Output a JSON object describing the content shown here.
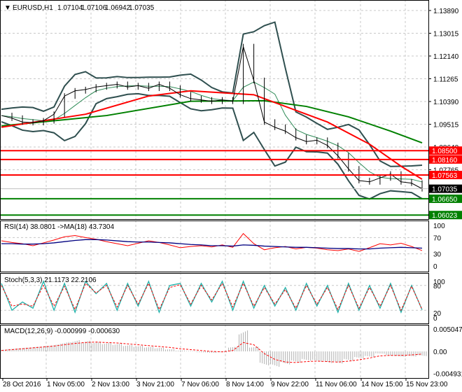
{
  "chart_data": {
    "type": "line",
    "symbol_header": "EURUSD,H1",
    "ohlc": {
      "open": "1.07104",
      "high": "1.07106",
      "low": "1.06942",
      "close": "1.07035"
    },
    "x_ticks": [
      "28 Oct 2016",
      "1 Nov 05:00",
      "2 Nov 13:00",
      "3 Nov 21:00",
      "7 Nov 06:00",
      "8 Nov 14:00",
      "9 Nov 22:00",
      "11 Nov 06:00",
      "14 Nov 15:00",
      "15 Nov 23:00"
    ],
    "price_axis": {
      "ylim": [
        1.0595,
        1.1415
      ],
      "ticks": [
        "1.13890",
        "1.13015",
        "1.12140",
        "1.11265",
        "1.10390",
        "1.09515",
        "1.08640",
        "1.07765"
      ]
    },
    "price": [
      1.0985,
      1.0975,
      1.096,
      1.0958,
      1.0965,
      1.099,
      1.106,
      1.108,
      1.1085,
      1.1095,
      1.11,
      1.1105,
      1.1095,
      1.11,
      1.109,
      1.1105,
      1.109,
      1.1065,
      1.105,
      1.1045,
      1.104,
      1.1045,
      1.104,
      1.125,
      1.112,
      1.096,
      1.094,
      1.0925,
      1.09,
      1.0885,
      1.089,
      1.087,
      1.083,
      1.078,
      1.0735,
      1.073,
      1.0745,
      1.076,
      1.073,
      1.0725,
      1.07035
    ],
    "ma_red": [
      [
        0,
        1.094
      ],
      [
        8,
        1.099
      ],
      [
        14,
        1.106
      ],
      [
        18,
        1.108
      ],
      [
        24,
        1.1065
      ],
      [
        27,
        1.102
      ],
      [
        31,
        1.096
      ],
      [
        35,
        1.0875
      ],
      [
        38,
        1.079
      ],
      [
        40,
        1.074
      ]
    ],
    "ma_green": [
      [
        0,
        1.0945
      ],
      [
        10,
        1.0985
      ],
      [
        18,
        1.104
      ],
      [
        25,
        1.1042
      ],
      [
        29,
        1.102
      ],
      [
        33,
        1.098
      ],
      [
        37,
        1.0925
      ],
      [
        40,
        1.088
      ]
    ],
    "levels": [
      {
        "value": "1.08500",
        "color": "#ff0000"
      },
      {
        "value": "1.08160",
        "color": "#ff0000"
      },
      {
        "value": "1.07563",
        "color": "#ff0000"
      },
      {
        "value": "1.06650",
        "color": "#008000"
      },
      {
        "value": "1.06023",
        "color": "#008000"
      }
    ],
    "current_price": "1.07035",
    "rsi": {
      "label": "RSI(14) 38.0801  ->MA(18) 43.7304",
      "ticks": [
        "100",
        "70",
        "30",
        "0"
      ],
      "values": [
        62,
        58,
        55,
        50,
        57,
        64,
        72,
        75,
        70,
        66,
        60,
        55,
        50,
        56,
        62,
        58,
        52,
        45,
        48,
        50,
        47,
        52,
        46,
        80,
        55,
        40,
        45,
        48,
        42,
        46,
        44,
        40,
        38,
        42,
        36,
        45,
        55,
        52,
        56,
        48,
        38
      ],
      "ma": [
        55,
        55,
        54,
        54,
        55,
        57,
        60,
        63,
        65,
        65,
        64,
        62,
        60,
        59,
        59,
        58,
        57,
        55,
        53,
        52,
        50,
        50,
        49,
        52,
        51,
        49,
        48,
        47,
        46,
        46,
        45,
        44,
        43,
        43,
        42,
        42,
        44,
        45,
        46,
        45,
        44
      ]
    },
    "stoch": {
      "label": "Stoch(5,3,3) 21.1173 22.2106",
      "ticks": [
        "100",
        "80",
        "20",
        "0"
      ],
      "main": [
        85,
        20,
        40,
        25,
        90,
        20,
        85,
        15,
        90,
        60,
        85,
        20,
        85,
        30,
        90,
        15,
        80,
        85,
        30,
        85,
        40,
        90,
        20,
        90,
        25,
        80,
        30,
        75,
        20,
        85,
        30,
        80,
        15,
        85,
        20,
        80,
        25,
        85,
        15,
        80,
        21
      ],
      "signal": [
        80,
        30,
        35,
        30,
        80,
        30,
        78,
        22,
        85,
        62,
        80,
        28,
        80,
        35,
        85,
        22,
        75,
        82,
        35,
        80,
        45,
        85,
        28,
        85,
        30,
        75,
        35,
        70,
        25,
        80,
        35,
        75,
        22,
        80,
        25,
        75,
        30,
        80,
        20,
        78,
        22
      ]
    },
    "macd": {
      "label": "MACD(12,26,9) -0.000999 -0.000630",
      "ticks": [
        "0.005047",
        "0.00",
        "-0.004931"
      ],
      "hist": [
        0.0004,
        0.0006,
        0.0008,
        0.001,
        0.0012,
        0.0015,
        0.002,
        0.0024,
        0.0023,
        0.0021,
        0.0019,
        0.0017,
        0.0014,
        0.0012,
        0.001,
        0.0008,
        0.0005,
        0.0002,
        0.0001,
        -0.0002,
        -0.0003,
        -0.0002,
        0.001,
        0.0045,
        0.001,
        -0.003,
        -0.0033,
        -0.0028,
        -0.0024,
        -0.002,
        -0.0022,
        -0.0025,
        -0.0026,
        -0.002,
        -0.0015,
        -0.0012,
        -0.0005,
        -0.001,
        -0.0012,
        -0.0011,
        -0.001
      ],
      "signal": [
        0.0002,
        0.0004,
        0.0006,
        0.0008,
        0.001,
        0.0012,
        0.0015,
        0.0018,
        0.002,
        0.0021,
        0.002,
        0.0019,
        0.0017,
        0.0015,
        0.0013,
        0.0011,
        0.0009,
        0.0006,
        0.0004,
        0.0002,
        0.0,
        -0.0001,
        0.0002,
        0.002,
        0.0015,
        -0.0005,
        -0.0018,
        -0.0024,
        -0.0025,
        -0.0023,
        -0.0022,
        -0.0023,
        -0.0024,
        -0.0022,
        -0.0019,
        -0.0015,
        -0.001,
        -0.0009,
        -0.0009,
        -0.0008,
        -0.0006
      ]
    }
  }
}
